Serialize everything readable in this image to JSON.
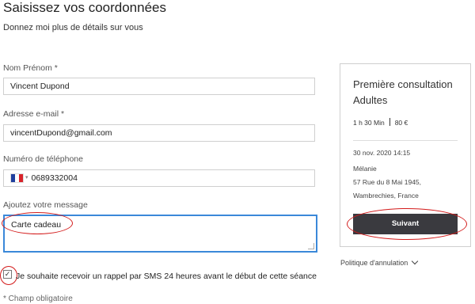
{
  "header": {
    "title": "Saisissez vos coordonnées",
    "subtitle": "Donnez moi plus de détails sur vous"
  },
  "form": {
    "name": {
      "label": "Nom Prénom *",
      "value": "Vincent Dupond"
    },
    "email": {
      "label": "Adresse e-mail *",
      "value": "vincentDupond@gmail.com"
    },
    "phone": {
      "label": "Numéro de téléphone",
      "value": "0689332004",
      "country_icon": "france-flag-icon"
    },
    "message": {
      "label": "Ajoutez votre message",
      "value": "Carte cadeau"
    },
    "sms_reminder": {
      "label": "Je souhaite recevoir un rappel par SMS 24 heures avant le début de cette séance",
      "checked": true
    },
    "required_note": "* Champ obligatoire"
  },
  "summary": {
    "title": "Première consultation Adultes",
    "duration": "1 h 30 Min",
    "price": "80 €",
    "datetime": "30 nov. 2020 14:15",
    "practitioner": "Mélanie",
    "address_line1": "57 Rue du 8 Mai 1945,",
    "address_line2": "Wambrechies, France",
    "next_button": "Suivant"
  },
  "policy_link": "Politique d'annulation",
  "colors": {
    "focus_border": "#3a88d9",
    "button_bg": "#3a3a3f",
    "annotation": "#d31a1a"
  }
}
